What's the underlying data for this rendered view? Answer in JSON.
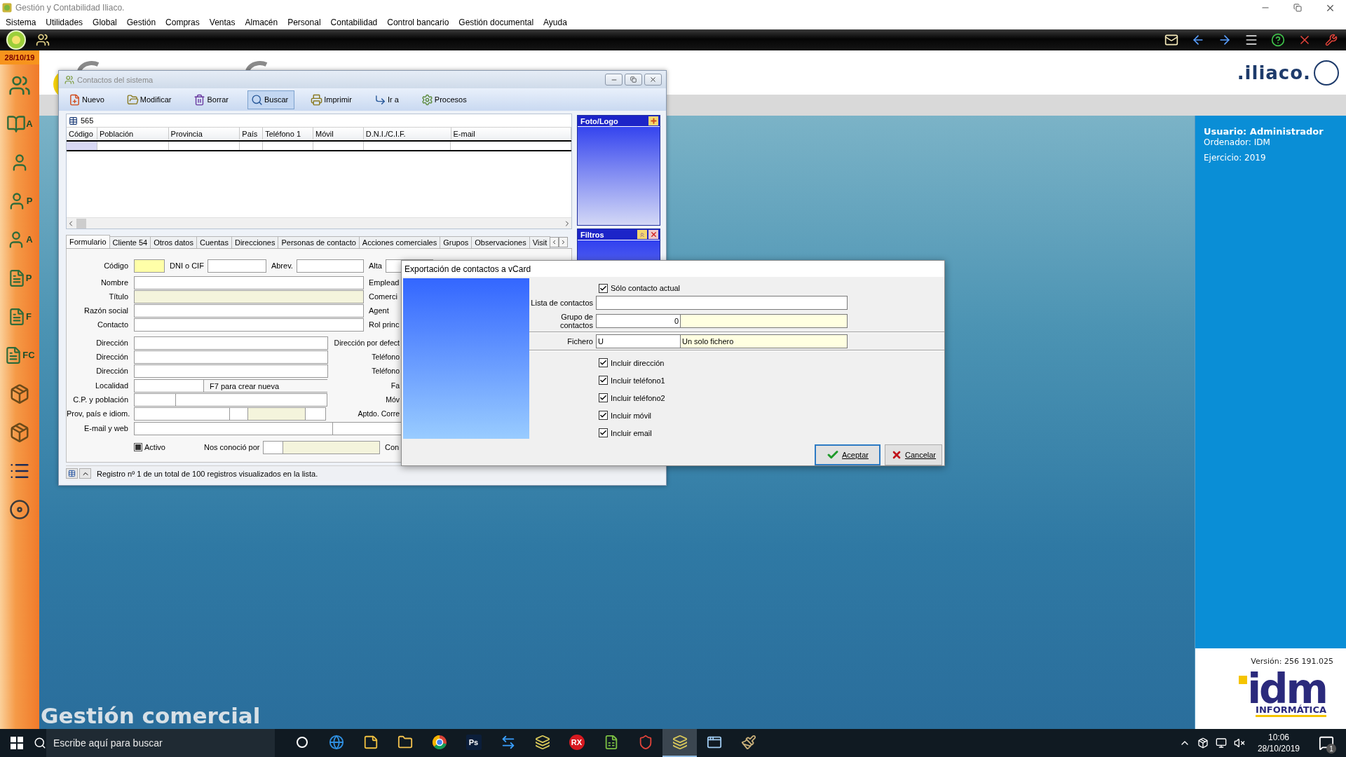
{
  "app_window": {
    "title": "Gestión y Contabilidad Iliaco."
  },
  "menu": [
    "Sistema",
    "Utilidades",
    "Global",
    "Gestión",
    "Compras",
    "Ventas",
    "Almacén",
    "Personal",
    "Contabilidad",
    "Control bancario",
    "Gestión documental",
    "Ayuda"
  ],
  "top_toolbar": {
    "left": [
      {
        "kind": "orb"
      },
      {
        "kind": "people"
      }
    ],
    "right": [
      {
        "kind": "mail"
      },
      {
        "kind": "back"
      },
      {
        "kind": "forward"
      },
      {
        "kind": "menu"
      },
      {
        "kind": "help"
      },
      {
        "kind": "close"
      },
      {
        "kind": "tools"
      }
    ]
  },
  "sidebar": {
    "date": "28/10/19",
    "items": [
      {
        "kind": "people"
      },
      {
        "kind": "book",
        "letter": "A"
      },
      {
        "kind": "person"
      },
      {
        "kind": "person",
        "letter": "P"
      },
      {
        "kind": "person",
        "letter": "A"
      },
      {
        "kind": "page",
        "letter": "P"
      },
      {
        "kind": "page",
        "letter": "F"
      },
      {
        "kind": "page",
        "letter": "FC"
      },
      {
        "kind": "box"
      },
      {
        "kind": "box"
      },
      {
        "kind": "list"
      },
      {
        "kind": "disc"
      }
    ]
  },
  "header": {
    "logo_text": ".iliaco."
  },
  "module_title": "Gestión comercial",
  "user_panel": {
    "lines": [
      {
        "text": "Usuario: Administrador",
        "kind": "strong"
      },
      {
        "text": "Ordenador: IDM",
        "kind": "plain"
      },
      {
        "text": "Ejercicio: 2019",
        "kind": "spaced"
      }
    ],
    "version": "Versión: 256 191.025",
    "brand": "idm",
    "brand_sub": "INFORMÁTICA"
  },
  "contacts_window": {
    "title": "Contactos del sistema",
    "toolbar": [
      {
        "label": "Nuevo",
        "kind": "new",
        "selected": false
      },
      {
        "label": "Modificar",
        "kind": "edit",
        "selected": false
      },
      {
        "label": "Borrar",
        "kind": "delete",
        "selected": false
      },
      {
        "label": "Buscar",
        "kind": "search",
        "selected": true
      },
      {
        "label": "Imprimir",
        "kind": "print",
        "selected": false
      },
      {
        "label": "Ir a",
        "kind": "goto",
        "selected": false
      },
      {
        "label": "Procesos",
        "kind": "process",
        "selected": false
      }
    ],
    "record_count": "565",
    "columns": [
      "Código",
      "Población",
      "Provincia",
      "País",
      "Teléfono 1",
      "Móvil",
      "D.N.I./C.I.F.",
      "E-mail"
    ],
    "rows": [
      {
        "selected": true
      }
    ],
    "photo_panel": {
      "title": "Foto/Logo"
    },
    "filters_panel": {
      "title": "Filtros"
    },
    "tabs": [
      {
        "label": "Formulario",
        "selected": true
      },
      {
        "label": "Cliente 54",
        "selected": false
      },
      {
        "label": "Otros datos",
        "selected": false
      },
      {
        "label": "Cuentas",
        "selected": false
      },
      {
        "label": "Direcciones",
        "selected": false
      },
      {
        "label": "Personas de contacto",
        "selected": false
      },
      {
        "label": "Acciones comerciales",
        "selected": false
      },
      {
        "label": "Grupos",
        "selected": false
      },
      {
        "label": "Observaciones",
        "selected": false
      },
      {
        "label": "Visit",
        "selected": false
      }
    ],
    "form_rows": [
      {
        "label": "Código",
        "items": [
          {
            "kind": "required"
          },
          {
            "kind": "label",
            "text": "DNI o CIF"
          },
          {
            "kind": "input"
          },
          {
            "kind": "label",
            "text": "Abrev."
          },
          {
            "kind": "input"
          },
          {
            "kind": "label",
            "text": "Alta"
          },
          {
            "kind": "input"
          }
        ]
      },
      {
        "label": "Nombre",
        "items": [
          {
            "kind": "input"
          }
        ],
        "side_label": "Emplead"
      },
      {
        "label": "Título",
        "items": [
          {
            "kind": "readonly"
          }
        ],
        "side_label": "Comerci"
      },
      {
        "label": "Razón social",
        "items": [
          {
            "kind": "input"
          }
        ],
        "side_label": "Agent"
      },
      {
        "label": "Contacto",
        "items": [
          {
            "kind": "input"
          }
        ],
        "side_label": "Rol princ"
      },
      {
        "label": "Dirección",
        "items": [
          {
            "kind": "input"
          }
        ],
        "side_label": "Dirección por defect"
      },
      {
        "label": "Dirección",
        "items": [
          {
            "kind": "input"
          }
        ],
        "side_label": "Teléfono"
      },
      {
        "label": "Dirección",
        "items": [
          {
            "kind": "input"
          }
        ],
        "side_label": "Teléfono"
      },
      {
        "label": "Localidad",
        "items": [
          {
            "kind": "input"
          },
          {
            "kind": "note",
            "text": "F7 para crear nueva"
          }
        ],
        "side_label": "Fa"
      },
      {
        "label": "C.P. y población",
        "items": [
          {
            "kind": "input"
          },
          {
            "kind": "input"
          }
        ],
        "side_label": "Móv"
      },
      {
        "label": "Prov, país e idiom.",
        "items": [
          {
            "kind": "input"
          },
          {
            "kind": "input"
          },
          {
            "kind": "readonly"
          },
          {
            "kind": "input"
          }
        ],
        "side_label": "Aptdo. Corre"
      },
      {
        "label": "E-mail y web",
        "items": [
          {
            "kind": "input"
          },
          {
            "kind": "input"
          }
        ]
      }
    ],
    "active": {
      "label": "Activo",
      "checked": true
    },
    "referral": {
      "label": "Nos conoció por"
    },
    "trailing_label": "Con",
    "status": "Registro nº 1 de un total de 100 registros visualizados en la lista."
  },
  "export_dialog": {
    "title": "Exportación de contactos a vCard",
    "current_only": {
      "label": "Sólo contacto actual",
      "checked": true
    },
    "list_field": {
      "label": "Lista de contactos"
    },
    "group_field": {
      "label": "Grupo de contactos",
      "value": "0"
    },
    "file_field": {
      "label": "Fichero",
      "value": "U",
      "description": "Un solo fichero"
    },
    "options": [
      {
        "label": "Incluir dirección",
        "checked": true
      },
      {
        "label": "Incluir teléfono1",
        "checked": true
      },
      {
        "label": "Incluir teléfono2",
        "checked": true
      },
      {
        "label": "Incluir móvil",
        "checked": true
      },
      {
        "label": "Incluir email",
        "checked": true
      }
    ],
    "buttons": [
      {
        "label": "Aceptar",
        "kind": "ok",
        "selected": true
      },
      {
        "label": "Cancelar",
        "kind": "cancel",
        "selected": false
      }
    ]
  },
  "taskbar": {
    "placeholder": "Escribe aquí para buscar",
    "apps": [
      {
        "kind": "cortana",
        "selected": false
      },
      {
        "kind": "edge",
        "selected": false
      },
      {
        "kind": "notes",
        "selected": false
      },
      {
        "kind": "folder",
        "selected": false
      },
      {
        "kind": "chrome",
        "selected": false
      },
      {
        "kind": "badge",
        "label": "Ps",
        "selected": false
      },
      {
        "kind": "remote",
        "selected": false
      },
      {
        "kind": "app",
        "selected": false
      },
      {
        "kind": "round",
        "label": "RX",
        "selected": false
      },
      {
        "kind": "sheet",
        "selected": false
      },
      {
        "kind": "shield",
        "selected": false
      },
      {
        "kind": "app",
        "selected": true
      },
      {
        "kind": "window",
        "selected": false
      },
      {
        "kind": "paint",
        "selected": false
      }
    ],
    "time": "10:06",
    "date": "28/10/2019",
    "notifications": "1"
  }
}
